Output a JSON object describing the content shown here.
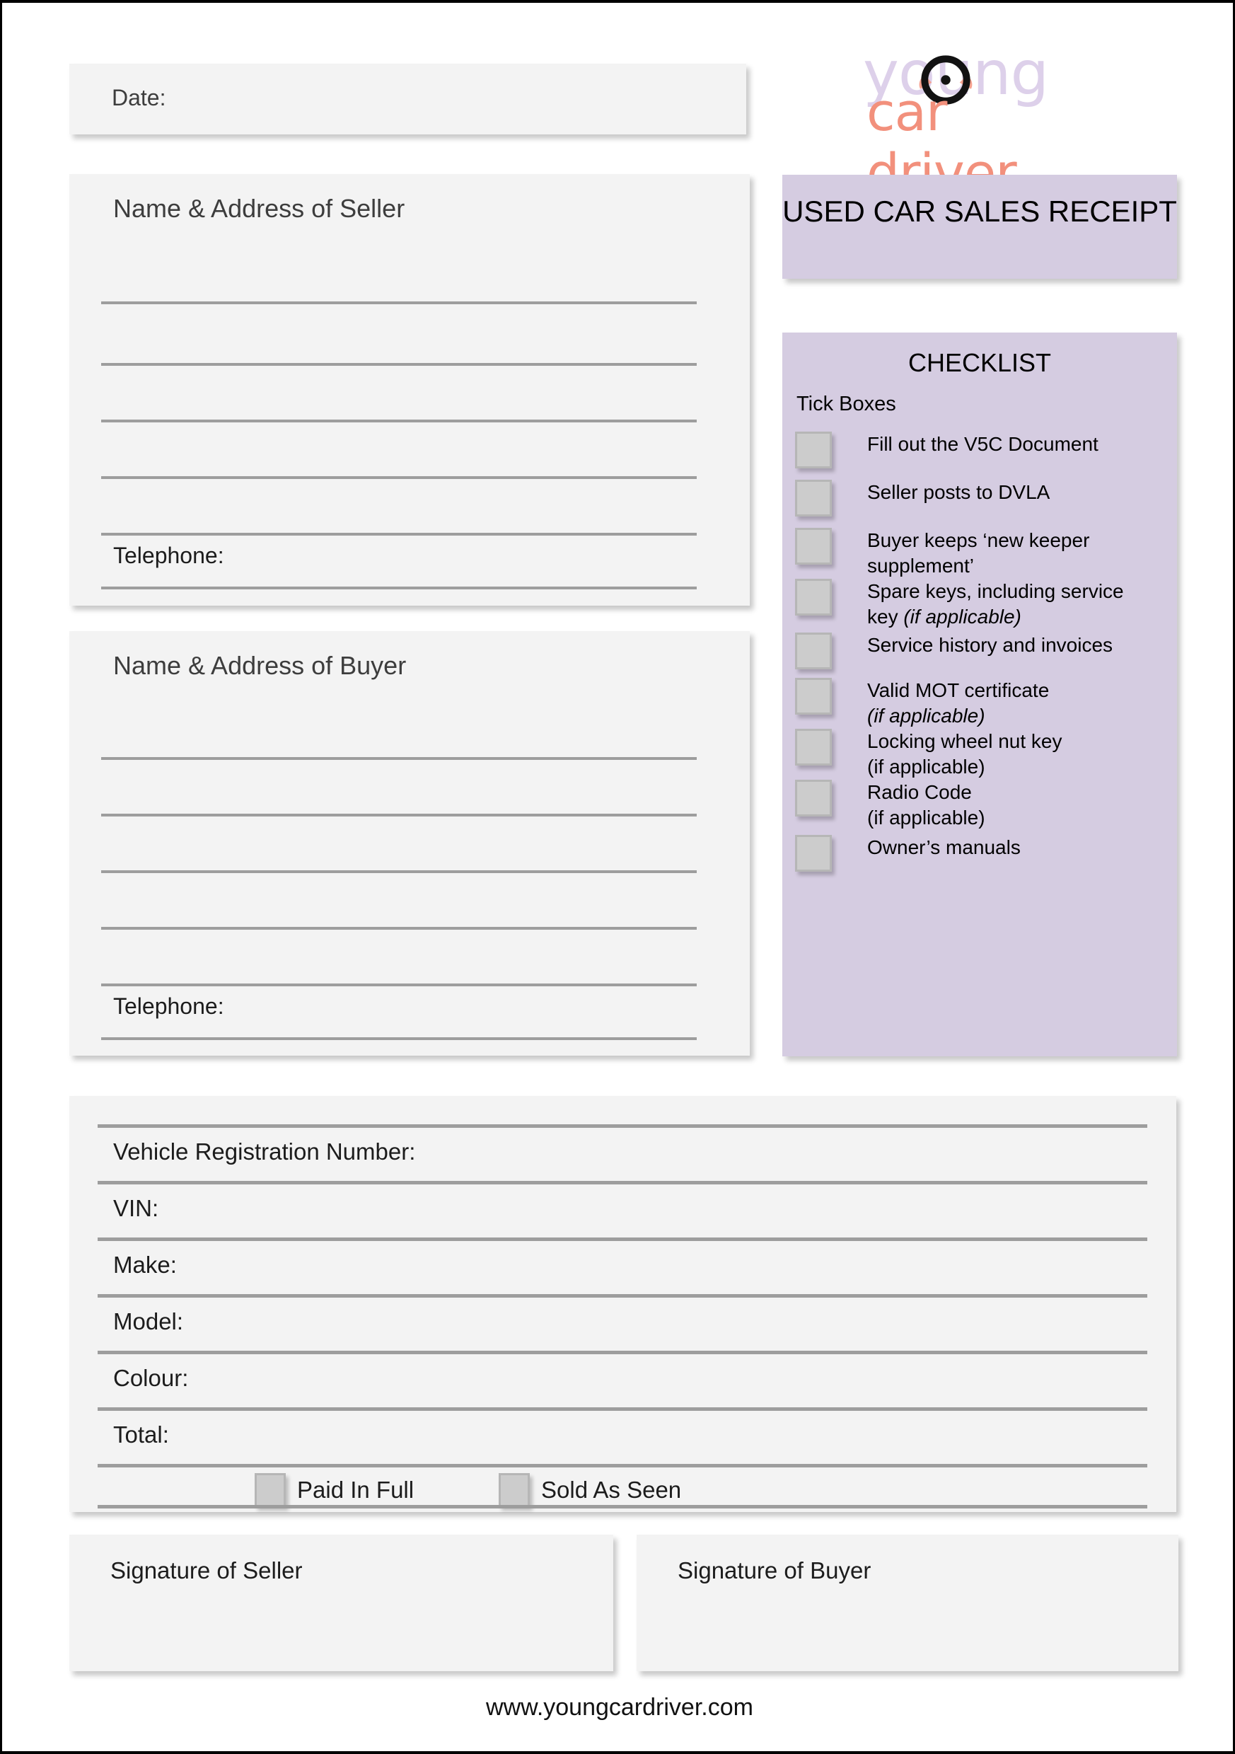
{
  "document": {
    "date_label": "Date:",
    "footer_url": "www.youngcardriver.com"
  },
  "logo": {
    "word_top": "young",
    "word_bottom": "car driver",
    "purple": "#ddd0ea",
    "salmon": "#f2907c",
    "wheel_icon": "steering-wheel-icon"
  },
  "receipt": {
    "title": "USED CAR SALES RECEIPT",
    "panel_color": "#d5cce1"
  },
  "seller": {
    "title": "Name & Address of Seller",
    "telephone_label": "Telephone:"
  },
  "buyer": {
    "title": "Name & Address of Buyer",
    "telephone_label": "Telephone:"
  },
  "checklist": {
    "title": "CHECKLIST",
    "tick_boxes_label": "Tick Boxes",
    "items": [
      {
        "label": "Fill out the V5C Document",
        "note": "",
        "note_italic": false
      },
      {
        "label": "Seller posts to DVLA",
        "note": "",
        "note_italic": false
      },
      {
        "label": "Buyer keeps ‘new keeper\nsupplement’",
        "note": "",
        "note_italic": false
      },
      {
        "label": "Spare keys, including service\nkey ",
        "note": "(if applicable)",
        "note_italic": true
      },
      {
        "label": "Service history and invoices",
        "note": "",
        "note_italic": false
      },
      {
        "label": "Valid MOT certificate\n",
        "note": "(if applicable)",
        "note_italic": true
      },
      {
        "label": "Locking wheel nut key\n(if applicable)",
        "note": "",
        "note_italic": false
      },
      {
        "label": "Radio Code\n(if applicable)",
        "note": "",
        "note_italic": false
      },
      {
        "label": "Owner’s manuals",
        "note": "",
        "note_italic": false
      }
    ]
  },
  "vehicle": {
    "fields": [
      {
        "label": "Vehicle Registration Number:"
      },
      {
        "label": "VIN:"
      },
      {
        "label": "Make:"
      },
      {
        "label": "Model:"
      },
      {
        "label": "Colour:"
      },
      {
        "label": "Total:"
      }
    ],
    "paid_in_full_label": "Paid In Full",
    "sold_as_seen_label": "Sold As Seen"
  },
  "signatures": {
    "seller_label": "Signature of Seller",
    "buyer_label": "Signature of Buyer"
  }
}
